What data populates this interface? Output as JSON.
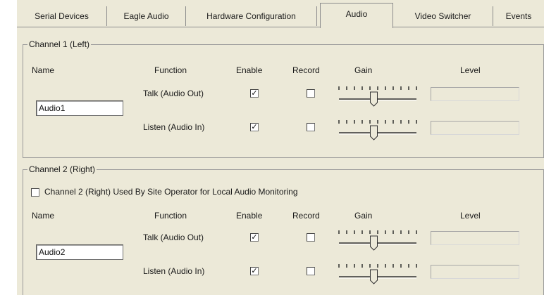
{
  "tabs": [
    {
      "label": "Serial Devices",
      "active": false
    },
    {
      "label": "Eagle Audio",
      "active": false
    },
    {
      "label": "Hardware Configuration",
      "active": false
    },
    {
      "label": "Audio",
      "active": true
    },
    {
      "label": "Video Switcher",
      "active": false
    },
    {
      "label": "Events",
      "active": false
    }
  ],
  "headers": {
    "name": "Name",
    "function": "Function",
    "enable": "Enable",
    "record": "Record",
    "gain": "Gain",
    "level": "Level"
  },
  "channel1": {
    "title": "Channel 1 (Left)",
    "name_value": "Audio1",
    "rows": [
      {
        "function": "Talk (Audio Out)",
        "enabled": true,
        "record": false,
        "gain_fraction": 0.45,
        "level": 0
      },
      {
        "function": "Listen (Audio In)",
        "enabled": true,
        "record": false,
        "gain_fraction": 0.45,
        "level": 0
      }
    ]
  },
  "channel2": {
    "title": "Channel 2 (Right)",
    "monitor_label": "Channel 2 (Right) Used By Site Operator for Local Audio Monitoring",
    "monitor_checked": false,
    "name_value": "Audio2",
    "rows": [
      {
        "function": "Talk (Audio Out)",
        "enabled": true,
        "record": false,
        "gain_fraction": 0.45,
        "level": 0
      },
      {
        "function": "Listen (Audio In)",
        "enabled": true,
        "record": false,
        "gain_fraction": 0.45,
        "level": 0
      }
    ]
  },
  "glyphs": {
    "check": "✓"
  }
}
